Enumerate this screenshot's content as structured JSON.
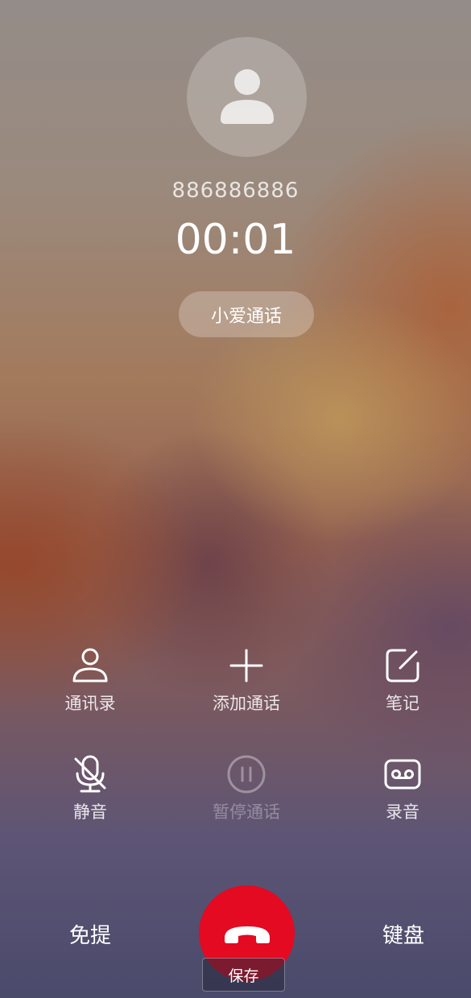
{
  "caller": {
    "avatar_icon": "person-icon",
    "number": "886886886",
    "duration": "00:01",
    "ai_call_label": "小爱通话"
  },
  "actions": [
    {
      "label": "通讯录",
      "icon": "contacts-icon",
      "enabled": true
    },
    {
      "label": "添加通话",
      "icon": "plus-icon",
      "enabled": true
    },
    {
      "label": "笔记",
      "icon": "note-icon",
      "enabled": true
    },
    {
      "label": "静音",
      "icon": "mic-off-icon",
      "enabled": true
    },
    {
      "label": "暂停通话",
      "icon": "pause-icon",
      "enabled": false
    },
    {
      "label": "录音",
      "icon": "record-icon",
      "enabled": true
    }
  ],
  "bottom": {
    "speaker_label": "免提",
    "keypad_label": "键盘",
    "hangup_icon": "hang-up-icon",
    "hangup_color": "#e30a22"
  },
  "tooltip": {
    "save_label": "保存"
  }
}
